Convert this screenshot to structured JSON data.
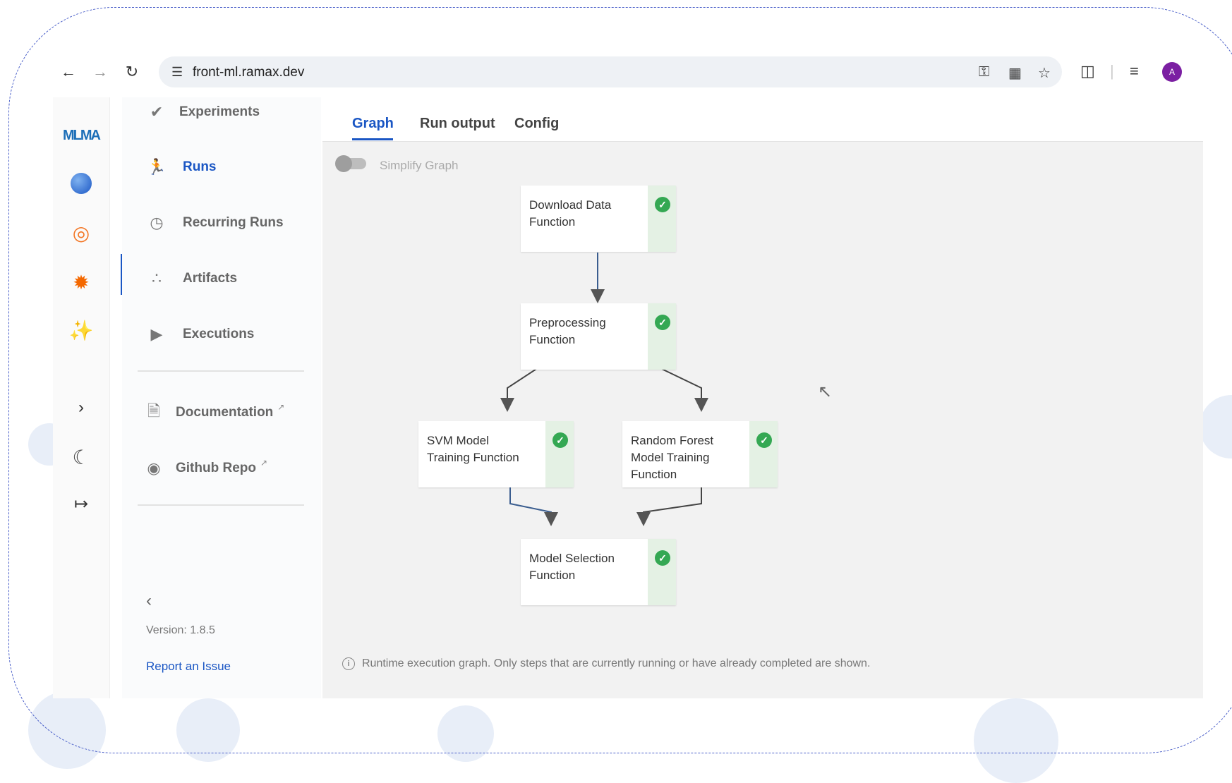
{
  "browser": {
    "url": "front-ml.ramax.dev",
    "profile_initial": "A",
    "icons": [
      "back-icon",
      "forward-icon",
      "reload-icon",
      "site-settings-icon",
      "password-key-icon",
      "translate-icon",
      "bookmark-star-icon",
      "extensions-icon",
      "media-queue-icon"
    ]
  },
  "rail": {
    "logo": "MLMA",
    "icons": [
      "kubeflow-icon",
      "jupyter-icon",
      "grafana-icon",
      "mlflow-icon",
      "expand-chevron-icon",
      "dark-mode-moon-icon",
      "logout-icon"
    ]
  },
  "sidebar": {
    "items": [
      {
        "label": "Experiments",
        "icon": "experiments-check-icon",
        "active": false
      },
      {
        "label": "Runs",
        "icon": "runs-running-icon",
        "active": true
      },
      {
        "label": "Recurring Runs",
        "icon": "alarm-clock-icon",
        "active": false
      },
      {
        "label": "Artifacts",
        "icon": "artifacts-bubbles-icon",
        "active": false
      },
      {
        "label": "Executions",
        "icon": "play-triangle-icon",
        "active": false
      }
    ],
    "links": [
      {
        "label": "Documentation",
        "icon": "document-icon"
      },
      {
        "label": "Github Repo",
        "icon": "github-icon"
      }
    ],
    "version": "Version: 1.8.5",
    "report_issue": "Report an Issue"
  },
  "main": {
    "tabs": [
      {
        "label": "Graph",
        "active": true
      },
      {
        "label": "Run output",
        "active": false
      },
      {
        "label": "Config",
        "active": false
      }
    ],
    "simplify_toggle": {
      "label": "Simplify Graph",
      "on": false
    },
    "nodes": [
      {
        "name": "Download Data Function",
        "status": "succeeded"
      },
      {
        "name": "Preprocessing Function",
        "status": "succeeded"
      },
      {
        "name": "SVM Model Training Function",
        "status": "succeeded"
      },
      {
        "name": "Random Forest Model Training Function",
        "status": "succeeded"
      },
      {
        "name": "Model Selection Function",
        "status": "succeeded"
      }
    ],
    "footer_note": "Runtime execution graph. Only steps that are currently running or have already completed are shown."
  },
  "colors": {
    "accent": "#1a56c4",
    "success": "#34a853",
    "status_bg": "#e4f1e4",
    "graph_bg": "#f2f2f2"
  }
}
